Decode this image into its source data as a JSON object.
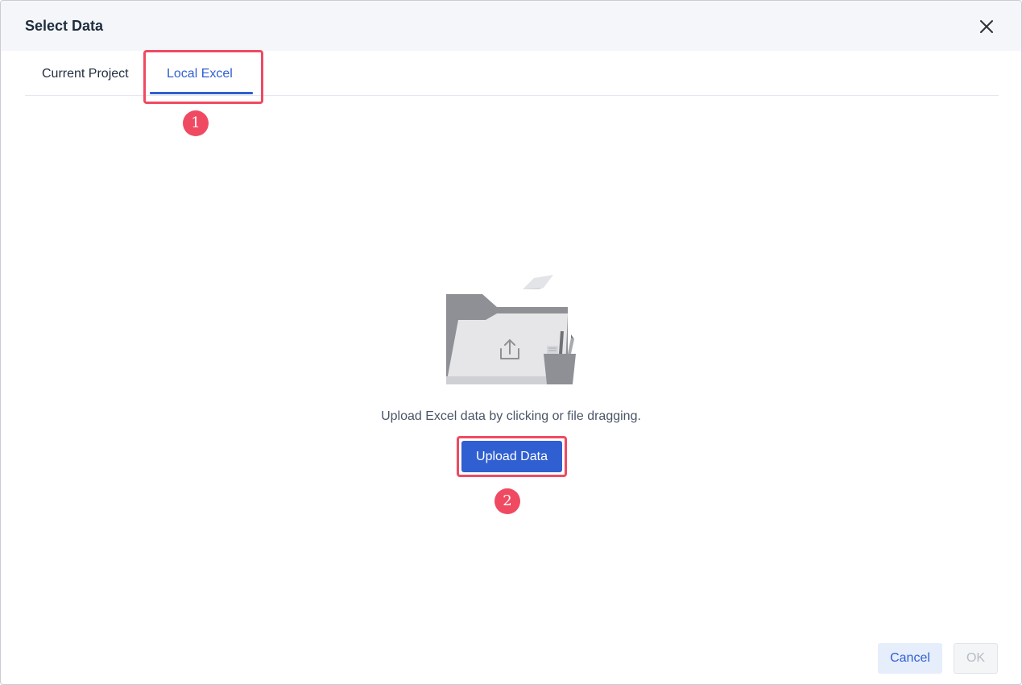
{
  "dialog": {
    "title": "Select Data",
    "close_icon": "close-icon"
  },
  "tabs": [
    {
      "label": "Current Project",
      "active": false
    },
    {
      "label": "Local Excel",
      "active": true
    }
  ],
  "upload": {
    "illustration_icon": "folder-upload-icon",
    "hint": "Upload Excel data by clicking or file dragging.",
    "button_label": "Upload Data"
  },
  "annotations": {
    "step1": "1",
    "step2": "2",
    "highlight_color": "#f04a62"
  },
  "footer": {
    "cancel_label": "Cancel",
    "ok_label": "OK",
    "ok_disabled": true
  },
  "colors": {
    "accent": "#2f5fd0",
    "header_bg": "#f4f6fa"
  }
}
